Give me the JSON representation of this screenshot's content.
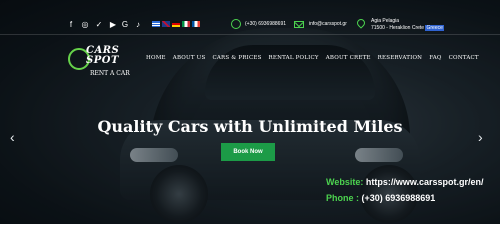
{
  "topbar": {
    "social_icons": [
      "facebook-icon",
      "instagram-icon",
      "twitter-icon",
      "youtube-icon",
      "google-icon",
      "tiktok-icon"
    ],
    "social_glyphs": [
      "f",
      "◎",
      "✓",
      "▶",
      "G",
      "♪"
    ],
    "languages": [
      {
        "code": "el",
        "colors": [
          "#2c6bd6",
          "#ffffff"
        ]
      },
      {
        "code": "en",
        "colors": [
          "#1f3a8a",
          "#c8102e"
        ]
      },
      {
        "code": "de",
        "colors": [
          "#111111",
          "#dd0000"
        ]
      },
      {
        "code": "it",
        "colors": [
          "#009246",
          "#ce2b37"
        ]
      },
      {
        "code": "fr",
        "colors": [
          "#0055a4",
          "#ef4135"
        ]
      }
    ],
    "phone": "(+30) 6936988691",
    "email": "info@carsspot.gr",
    "address_line1": "Agia Pelagia",
    "address_line2": "71500 - Heraklion Crete",
    "address_highlight": "Greece"
  },
  "logo": {
    "top": "CARS",
    "bottom": "SPOT",
    "sub": "RENT A CAR"
  },
  "nav": [
    "HOME",
    "ABOUT US",
    "CARS & PRICES",
    "RENTAL POLICY",
    "ABOUT CRETE",
    "RESERVATION",
    "FAQ",
    "CONTACT"
  ],
  "hero": {
    "title": "Quality Cars with Unlimited Miles",
    "button": "Book Now"
  },
  "overlay_info": {
    "website_label": "Website:",
    "website_value": " https://www.carsspot.gr/en/",
    "phone_label": "Phone :",
    "phone_value": " (+30) 6936988691"
  },
  "colors": {
    "accent_green": "#4cd34f",
    "button_green": "#1c9b47"
  }
}
